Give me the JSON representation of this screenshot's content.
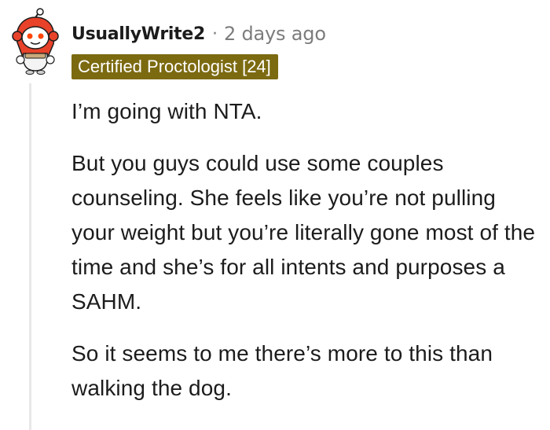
{
  "comment": {
    "avatar_icon": "snoo-avatar-icon",
    "username": "UsuallyWrite2",
    "separator": "·",
    "timestamp": "2 days ago",
    "flair": {
      "text": "Certified Proctologist [24]",
      "color": "#7c6a11"
    },
    "body": {
      "p1": "I’m going with NTA.",
      "p2": "But you guys could use some couples counseling. She feels like you’re not pulling your weight but you’re literally gone most of the time and she’s for all intents and purposes a SAHM.",
      "p3": "So it seems to me there’s more to this than walking the dog."
    }
  }
}
